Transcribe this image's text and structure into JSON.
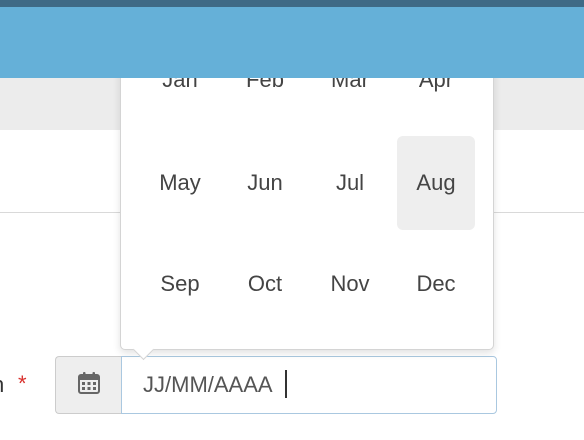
{
  "field": {
    "label": "n",
    "required_marker": "*",
    "placeholder": "JJ/MM/AAAA",
    "addon_icon": "calendar-icon"
  },
  "month_picker": {
    "selected": "Aug",
    "months": [
      "Jan",
      "Feb",
      "Mar",
      "Apr",
      "May",
      "Jun",
      "Jul",
      "Aug",
      "Sep",
      "Oct",
      "Nov",
      "Dec"
    ]
  },
  "colors": {
    "header_dark": "#3f6a86",
    "header_blue": "#65b0d8",
    "subheader_gray": "#ececec",
    "required": "#d9302c",
    "selected_month_bg": "#eeeeee",
    "input_focus_border": "#aac8e0"
  }
}
